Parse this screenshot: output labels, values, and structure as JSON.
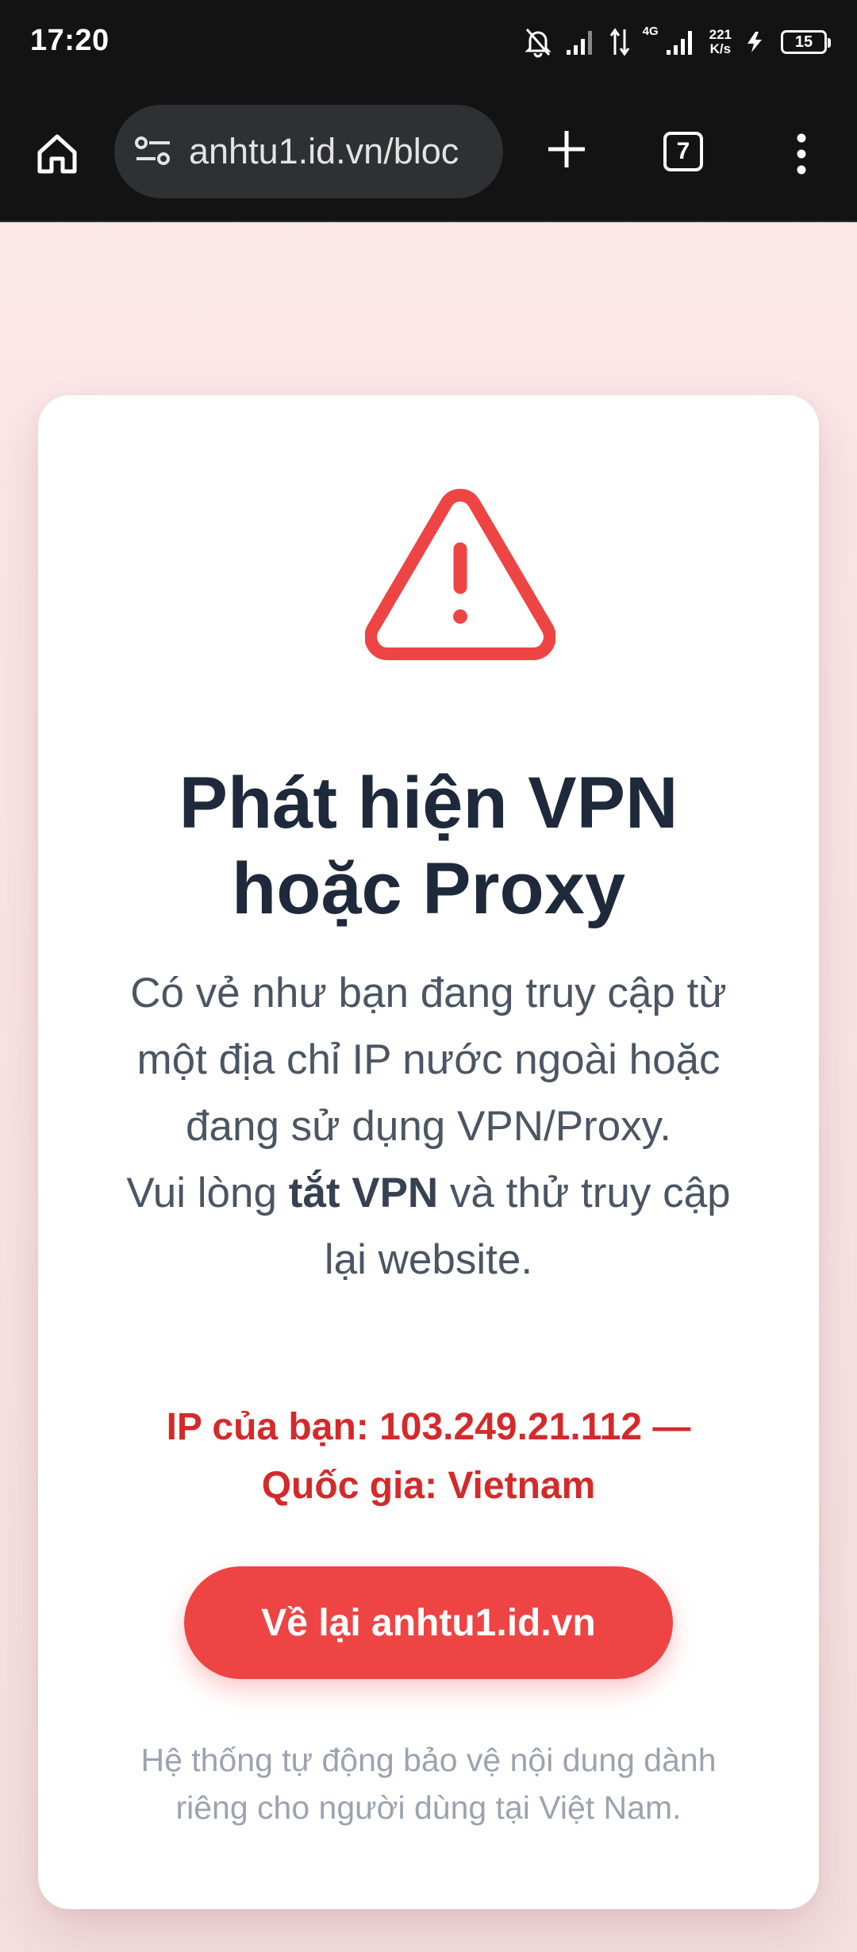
{
  "status_bar": {
    "time": "17:20",
    "network_gen": "4G",
    "speed_value": "221",
    "speed_unit": "K/s",
    "battery": "15"
  },
  "browser": {
    "url": "anhtu1.id.vn/bloc",
    "tab_count": "7",
    "icons": [
      "home-icon",
      "site-settings-icon",
      "plus-icon",
      "tabs-icon",
      "more-vert-icon"
    ]
  },
  "card": {
    "title_line1": "Phát hiện VPN",
    "title_line2": "hoặc Proxy",
    "desc_part1": "Có vẻ như bạn đang truy cập từ một địa chỉ IP nước ngoài hoặc đang sử dụng VPN/Proxy.",
    "desc_part2_pre": "Vui lòng ",
    "desc_part2_bold": "tắt VPN",
    "desc_part2_post": " và thử truy cập lại website.",
    "ip_line": "IP của bạn: 103.249.21.112 —",
    "country_line": "Quốc gia: Vietnam",
    "button_label": "Về lại anhtu1.id.vn",
    "footer": "Hệ thống tự động bảo vệ nội dung dành riêng cho người dùng tại Việt Nam."
  },
  "colors": {
    "accent": "#ef4444",
    "warning": "#d42a2a",
    "title": "#1e293b",
    "page_bg": "#fde8ea"
  }
}
